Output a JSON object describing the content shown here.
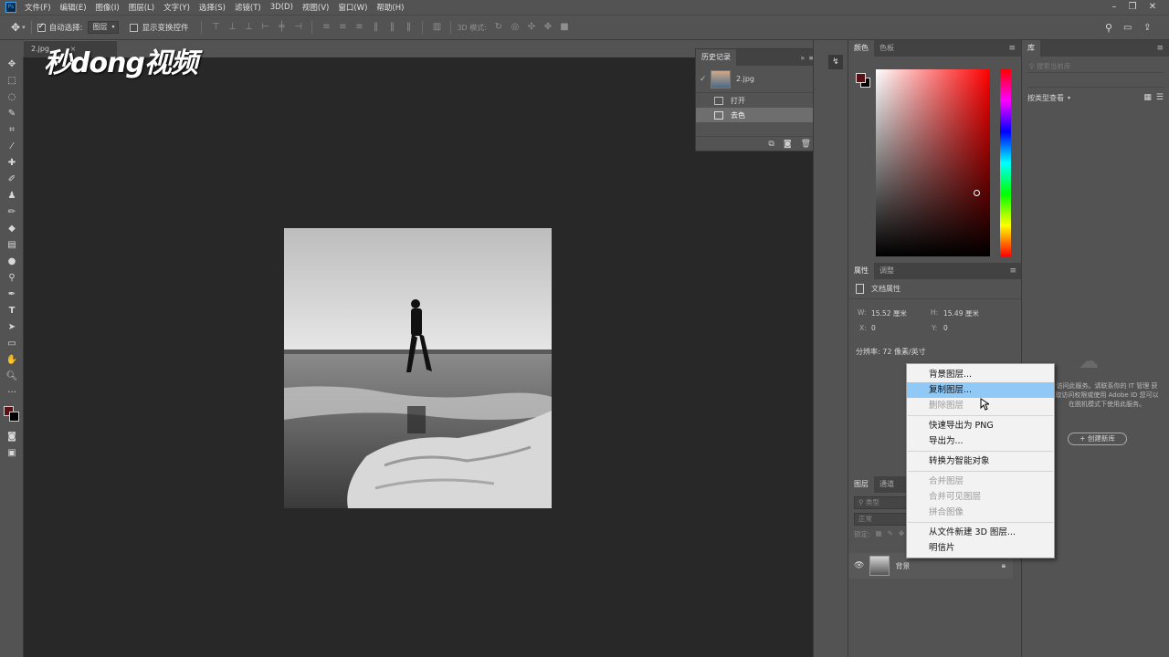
{
  "app": {
    "logo": "Ps"
  },
  "menu": [
    "文件(F)",
    "编辑(E)",
    "图像(I)",
    "图层(L)",
    "文字(Y)",
    "选择(S)",
    "滤镜(T)",
    "3D(D)",
    "视图(V)",
    "窗口(W)",
    "帮助(H)"
  ],
  "options": {
    "auto_select_label": "自动选择:",
    "auto_select_value": "图层",
    "show_transform_label": "显示变换控件",
    "mode_3d_label": "3D 模式:"
  },
  "document": {
    "tab_title": "2.jpg"
  },
  "watermark": {
    "text": "秒dong视频"
  },
  "history": {
    "title": "历史记录",
    "snapshot": "2.jpg",
    "items": [
      "打开",
      "去色"
    ]
  },
  "color_panel": {
    "tabs": [
      "颜色",
      "色板"
    ],
    "foreground": "#5b1114",
    "background": "#000000"
  },
  "properties": {
    "tabs": [
      "属性",
      "调整"
    ],
    "section": "文档属性",
    "w_label": "W:",
    "w_value": "15.52 厘米",
    "h_label": "H:",
    "h_value": "15.49 厘米",
    "x_label": "X:",
    "x_value": "0",
    "y_label": "Y:",
    "y_value": "0",
    "resolution": "分辨率: 72 像素/英寸"
  },
  "layers": {
    "tabs": [
      "图层",
      "通道"
    ],
    "filter_placeholder": "类型",
    "blend_mode": "正常",
    "lock_label": "锁定:",
    "layer_name": "背景"
  },
  "library": {
    "title": "库",
    "search_placeholder": "搜索当前库",
    "view_label": "按类型查看",
    "message": "访问此服务。请联系你的 IT 管理 获取访问权限或使用 Adobe ID 您可以在脱机模式下使用此服务。",
    "create_button": "+ 创建新库"
  },
  "context_menu": {
    "items": [
      {
        "label": "背景图层...",
        "disabled": false
      },
      {
        "label": "复制图层...",
        "disabled": false,
        "highlight": true
      },
      {
        "label": "删除图层",
        "disabled": true
      },
      {
        "sep": true
      },
      {
        "label": "快速导出为 PNG",
        "disabled": false
      },
      {
        "label": "导出为...",
        "disabled": false
      },
      {
        "sep": true
      },
      {
        "label": "转换为智能对象",
        "disabled": false
      },
      {
        "sep": true
      },
      {
        "label": "合并图层",
        "disabled": true
      },
      {
        "label": "合并可见图层",
        "disabled": true
      },
      {
        "label": "拼合图像",
        "disabled": true
      },
      {
        "sep": true
      },
      {
        "label": "从文件新建 3D 图层...",
        "disabled": false
      },
      {
        "label": "明信片",
        "disabled": false
      }
    ]
  }
}
